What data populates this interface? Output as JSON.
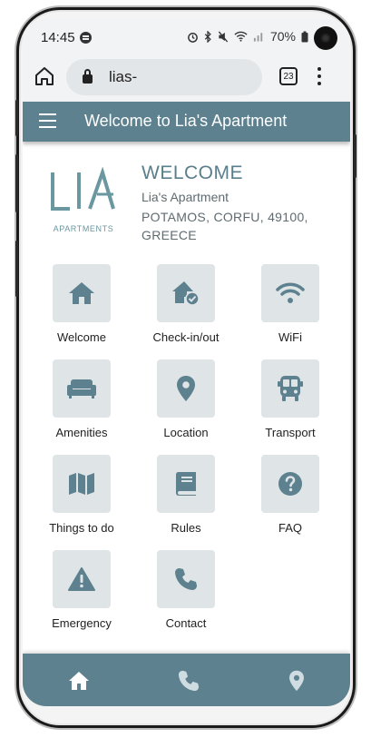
{
  "status_bar": {
    "time": "14:45",
    "battery": "70%"
  },
  "browser": {
    "url": "lias-",
    "tab_count": "23"
  },
  "header": {
    "title": "Welcome to Lia's Apartment"
  },
  "welcome": {
    "logo_text": "APARTMENTS",
    "heading": "WELCOME",
    "apartment_name": "Lia's Apartment",
    "address": "POTAMOS, CORFU, 49100, GREECE"
  },
  "menu": [
    {
      "label": "Welcome",
      "icon": "home-icon"
    },
    {
      "label": "Check-in/out",
      "icon": "home-check-icon"
    },
    {
      "label": "WiFi",
      "icon": "wifi-icon"
    },
    {
      "label": "Amenities",
      "icon": "sofa-icon"
    },
    {
      "label": "Location",
      "icon": "map-pin-icon"
    },
    {
      "label": "Transport",
      "icon": "bus-icon"
    },
    {
      "label": "Things to do",
      "icon": "map-icon"
    },
    {
      "label": "Rules",
      "icon": "book-icon"
    },
    {
      "label": "FAQ",
      "icon": "question-icon"
    },
    {
      "label": "Emergency",
      "icon": "warning-icon"
    },
    {
      "label": "Contact",
      "icon": "phone-icon"
    }
  ],
  "colors": {
    "primary": "#5d818e",
    "tile_bg": "#dfe4e7",
    "heading": "#5a7f8c"
  }
}
